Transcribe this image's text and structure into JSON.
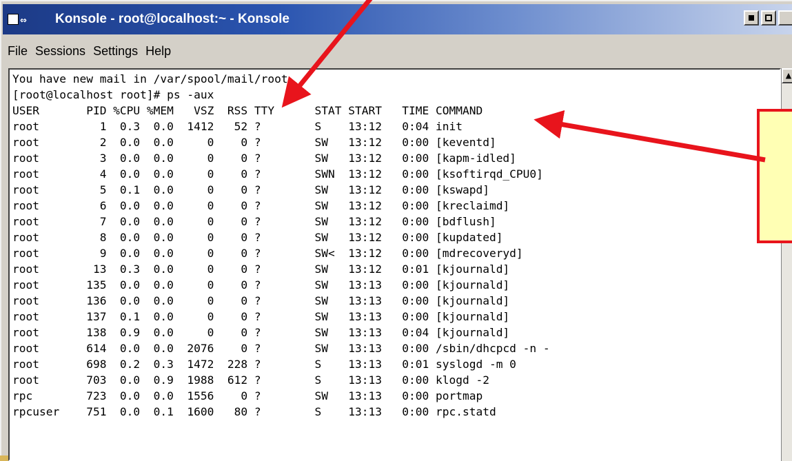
{
  "window": {
    "title": "Konsole - root@localhost:~ - Konsole",
    "system_icon_glyph": "⇔"
  },
  "menu": [
    "File",
    "Sessions",
    "Settings",
    "Help"
  ],
  "terminal": {
    "lines": [
      "You have new mail in /var/spool/mail/root",
      "[root@localhost root]# ps -aux",
      "USER       PID %CPU %MEM   VSZ  RSS TTY      STAT START   TIME COMMAND",
      "root         1  0.3  0.0  1412   52 ?        S    13:12   0:04 init",
      "root         2  0.0  0.0     0    0 ?        SW   13:12   0:00 [keventd]",
      "root         3  0.0  0.0     0    0 ?        SW   13:12   0:00 [kapm-idled]",
      "root         4  0.0  0.0     0    0 ?        SWN  13:12   0:00 [ksoftirqd_CPU0]",
      "root         5  0.1  0.0     0    0 ?        SW   13:12   0:00 [kswapd]",
      "root         6  0.0  0.0     0    0 ?        SW   13:12   0:00 [kreclaimd]",
      "root         7  0.0  0.0     0    0 ?        SW   13:12   0:00 [bdflush]",
      "root         8  0.0  0.0     0    0 ?        SW   13:12   0:00 [kupdated]",
      "root         9  0.0  0.0     0    0 ?        SW<  13:12   0:00 [mdrecoveryd]",
      "root        13  0.3  0.0     0    0 ?        SW   13:12   0:01 [kjournald]",
      "root       135  0.0  0.0     0    0 ?        SW   13:13   0:00 [kjournald]",
      "root       136  0.0  0.0     0    0 ?        SW   13:13   0:00 [kjournald]",
      "root       137  0.1  0.0     0    0 ?        SW   13:13   0:00 [kjournald]",
      "root       138  0.9  0.0     0    0 ?        SW   13:13   0:04 [kjournald]",
      "root       614  0.0  0.0  2076    0 ?        SW   13:13   0:00 /sbin/dhcpcd -n -",
      "root       698  0.2  0.3  1472  228 ?        S    13:13   0:01 syslogd -m 0",
      "root       703  0.0  0.9  1988  612 ?        S    13:13   0:00 klogd -2",
      "rpc        723  0.0  0.0  1556    0 ?        SW   13:13   0:00 portmap",
      "rpcuser    751  0.0  0.1  1600   80 ?        S    13:13   0:00 rpc.statd"
    ]
  },
  "annotation": {
    "callout_color": "#ffffb4",
    "arrow_color": "#e8141c"
  }
}
